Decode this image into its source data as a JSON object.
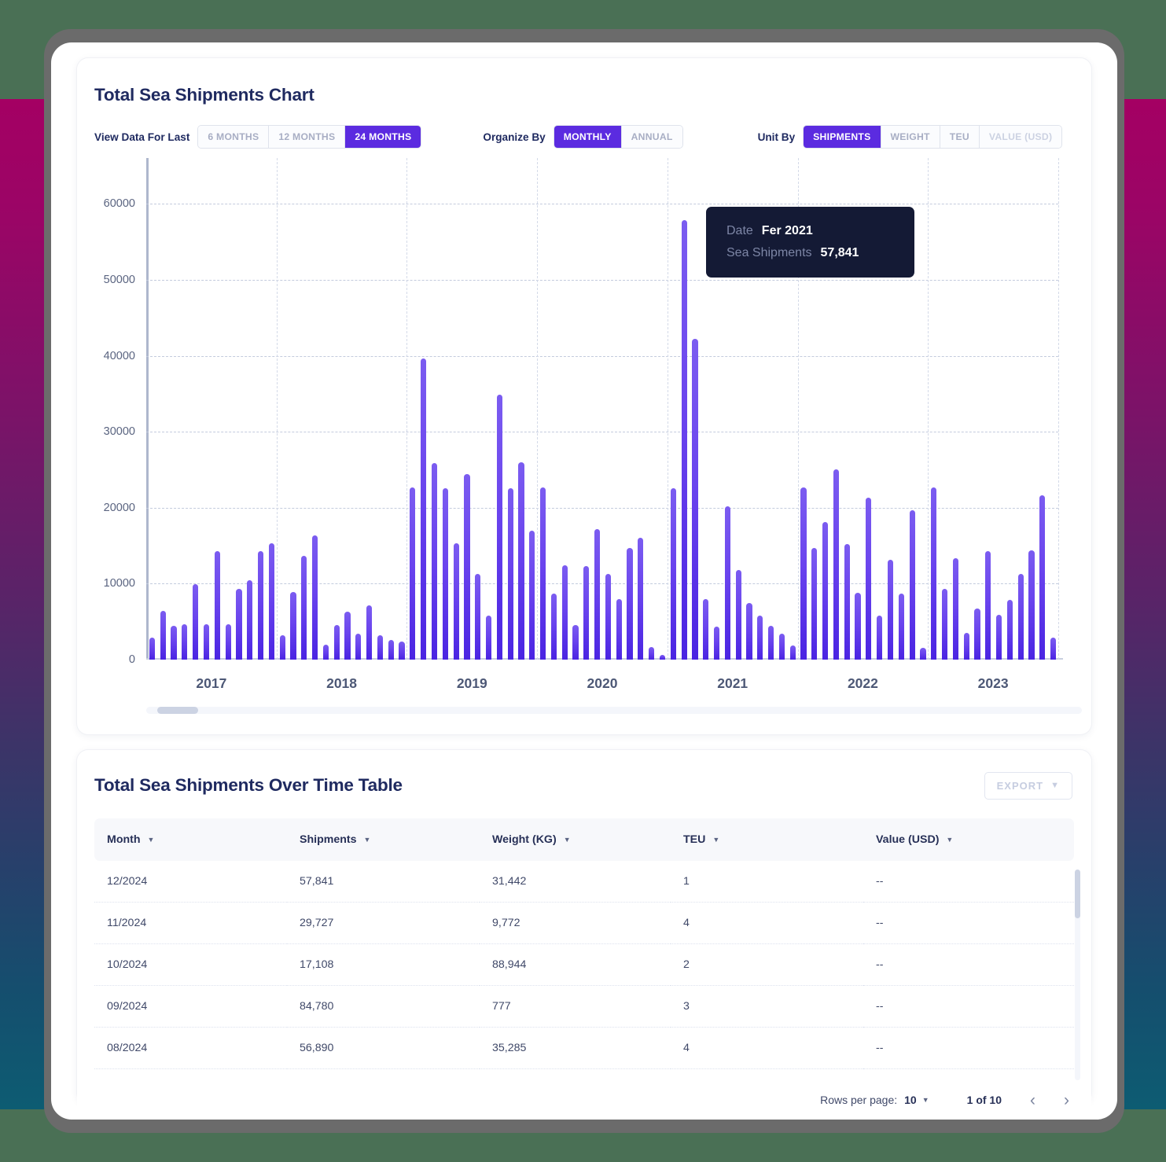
{
  "chart_card": {
    "title": "Total Sea Shipments Chart",
    "controls": {
      "view_label": "View Data For Last",
      "view_options": [
        "6 MONTHS",
        "12 MONTHS",
        "24 MONTHS"
      ],
      "view_selected": "24 MONTHS",
      "organize_label": "Organize By",
      "organize_options": [
        "MONTHLY",
        "ANNUAL"
      ],
      "organize_selected": "MONTHLY",
      "unit_label": "Unit By",
      "unit_options": [
        "SHIPMENTS",
        "WEIGHT",
        "TEU",
        "VALUE (USD)"
      ],
      "unit_selected": "SHIPMENTS",
      "unit_disabled": "VALUE (USD)"
    },
    "tooltip": {
      "date_key": "Date",
      "date_value": "Fer 2021",
      "metric_key": "Sea Shipments",
      "metric_value": "57,841"
    }
  },
  "chart_data": {
    "type": "bar",
    "title": "Total Sea Shipments Chart",
    "xlabel": "",
    "ylabel": "",
    "ylim": [
      0,
      65000
    ],
    "yticks": [
      0,
      10000,
      20000,
      30000,
      40000,
      50000,
      60000
    ],
    "ytick_labels": [
      "0",
      "10000",
      "20000",
      "30000",
      "40000",
      "50000",
      "60000"
    ],
    "grid": true,
    "legend": "none",
    "xtick_labels": [
      "2017",
      "2018",
      "2019",
      "2020",
      "2021",
      "2022",
      "2023"
    ],
    "series_name": "Sea Shipments",
    "bar_color": "#5b2be0",
    "highlighted_index": 49,
    "values": [
      2900,
      6400,
      4500,
      4700,
      9900,
      4700,
      14300,
      4700,
      9300,
      10500,
      14300,
      15300,
      3200,
      8900,
      13700,
      16400,
      2000,
      4600,
      6300,
      3400,
      7100,
      3200,
      2600,
      2400,
      22700,
      39600,
      25900,
      22600,
      15300,
      24400,
      11300,
      5800,
      34900,
      22600,
      26000,
      17000,
      22700,
      8700,
      12400,
      4600,
      12300,
      17200,
      11300,
      8000,
      14700,
      16000,
      1700,
      600,
      22600,
      57841,
      42200,
      8000,
      4300,
      20200,
      11800,
      7500,
      5800,
      4500,
      3400,
      1900,
      22700,
      14700,
      18100,
      25100,
      15200,
      8800,
      21300,
      5800,
      13100,
      8700,
      19700,
      1600,
      22700,
      9300,
      13400,
      3500,
      6700,
      14300,
      5900,
      7900,
      11300,
      14400,
      21600,
      2900
    ]
  },
  "table_card": {
    "title": "Total Sea Shipments Over Time Table",
    "export_label": "EXPORT",
    "columns": [
      "Month",
      "Shipments",
      "Weight (KG)",
      "TEU",
      "Value (USD)"
    ],
    "rows": [
      {
        "month": "12/2024",
        "shipments": "57,841",
        "weight": "31,442",
        "teu": "1",
        "value": "--"
      },
      {
        "month": "11/2024",
        "shipments": "29,727",
        "weight": "9,772",
        "teu": "4",
        "value": "--"
      },
      {
        "month": "10/2024",
        "shipments": "17,108",
        "weight": "88,944",
        "teu": "2",
        "value": "--"
      },
      {
        "month": "09/2024",
        "shipments": "84,780",
        "weight": "777",
        "teu": "3",
        "value": "--"
      },
      {
        "month": "08/2024",
        "shipments": "56,890",
        "weight": "35,285",
        "teu": "4",
        "value": "--"
      }
    ],
    "pagination": {
      "rows_per_page_label": "Rows per page:",
      "rows_per_page_value": "10",
      "page_indicator": "1 of 10",
      "prev_glyph": "‹",
      "next_glyph": "›"
    }
  },
  "theme": {
    "accent": "#5b2be0",
    "title_color": "#1f2a60",
    "tooltip_bg": "#141a35",
    "page_top_band": "#4a7055",
    "window_chrome": "#6b6b6b"
  }
}
